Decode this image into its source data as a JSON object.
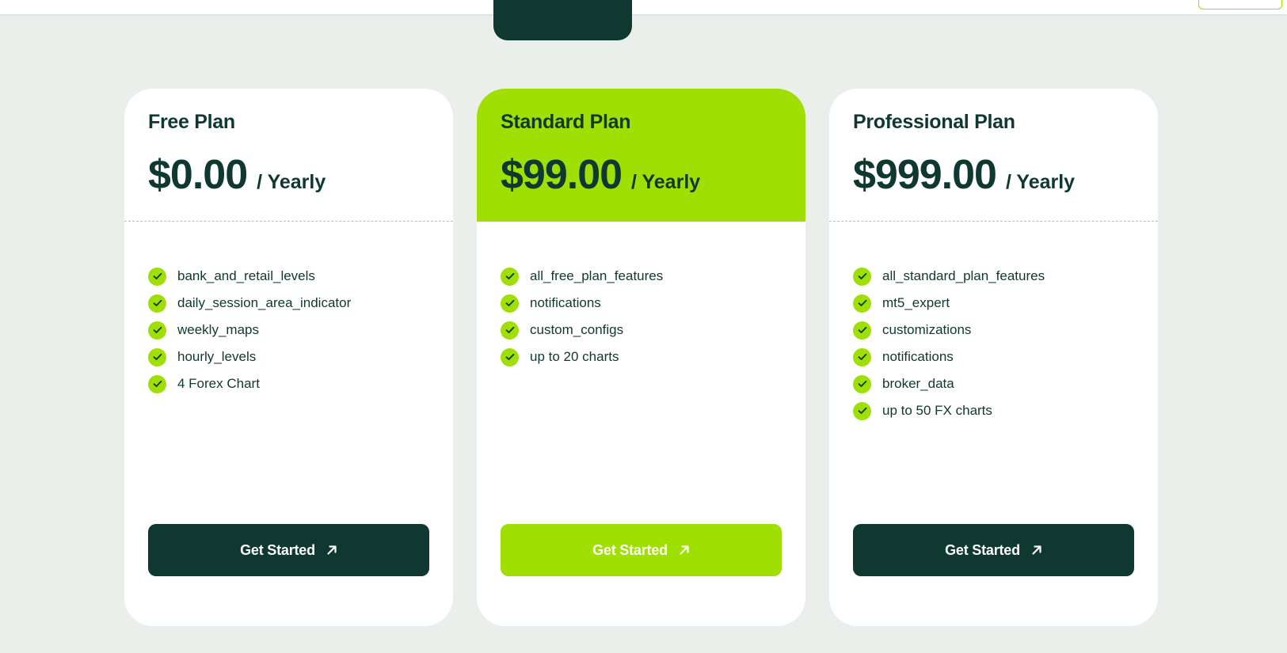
{
  "colors": {
    "accent": "#9fdf04",
    "dark": "#0e3830",
    "background": "#ebefec",
    "card": "#ffffff"
  },
  "plans": [
    {
      "name": "Free Plan",
      "price": "$0.00",
      "period": "/ Yearly",
      "featured": false,
      "features": [
        "bank_and_retail_levels",
        "daily_session_area_indicator",
        "weekly_maps",
        "hourly_levels",
        "4 Forex Chart"
      ],
      "cta": "Get Started",
      "cta_icon": "arrow-up-right-icon"
    },
    {
      "name": "Standard Plan",
      "price": "$99.00",
      "period": "/ Yearly",
      "featured": true,
      "features": [
        "all_free_plan_features",
        "notifications",
        "custom_configs",
        "up to 20 charts"
      ],
      "cta": "Get Started",
      "cta_icon": "arrow-up-right-icon"
    },
    {
      "name": "Professional Plan",
      "price": "$999.00",
      "period": "/ Yearly",
      "featured": false,
      "features": [
        "all_standard_plan_features",
        "mt5_expert",
        "customizations",
        "notifications",
        "broker_data",
        "up to 50 FX charts"
      ],
      "cta": "Get Started",
      "cta_icon": "arrow-up-right-icon"
    }
  ]
}
